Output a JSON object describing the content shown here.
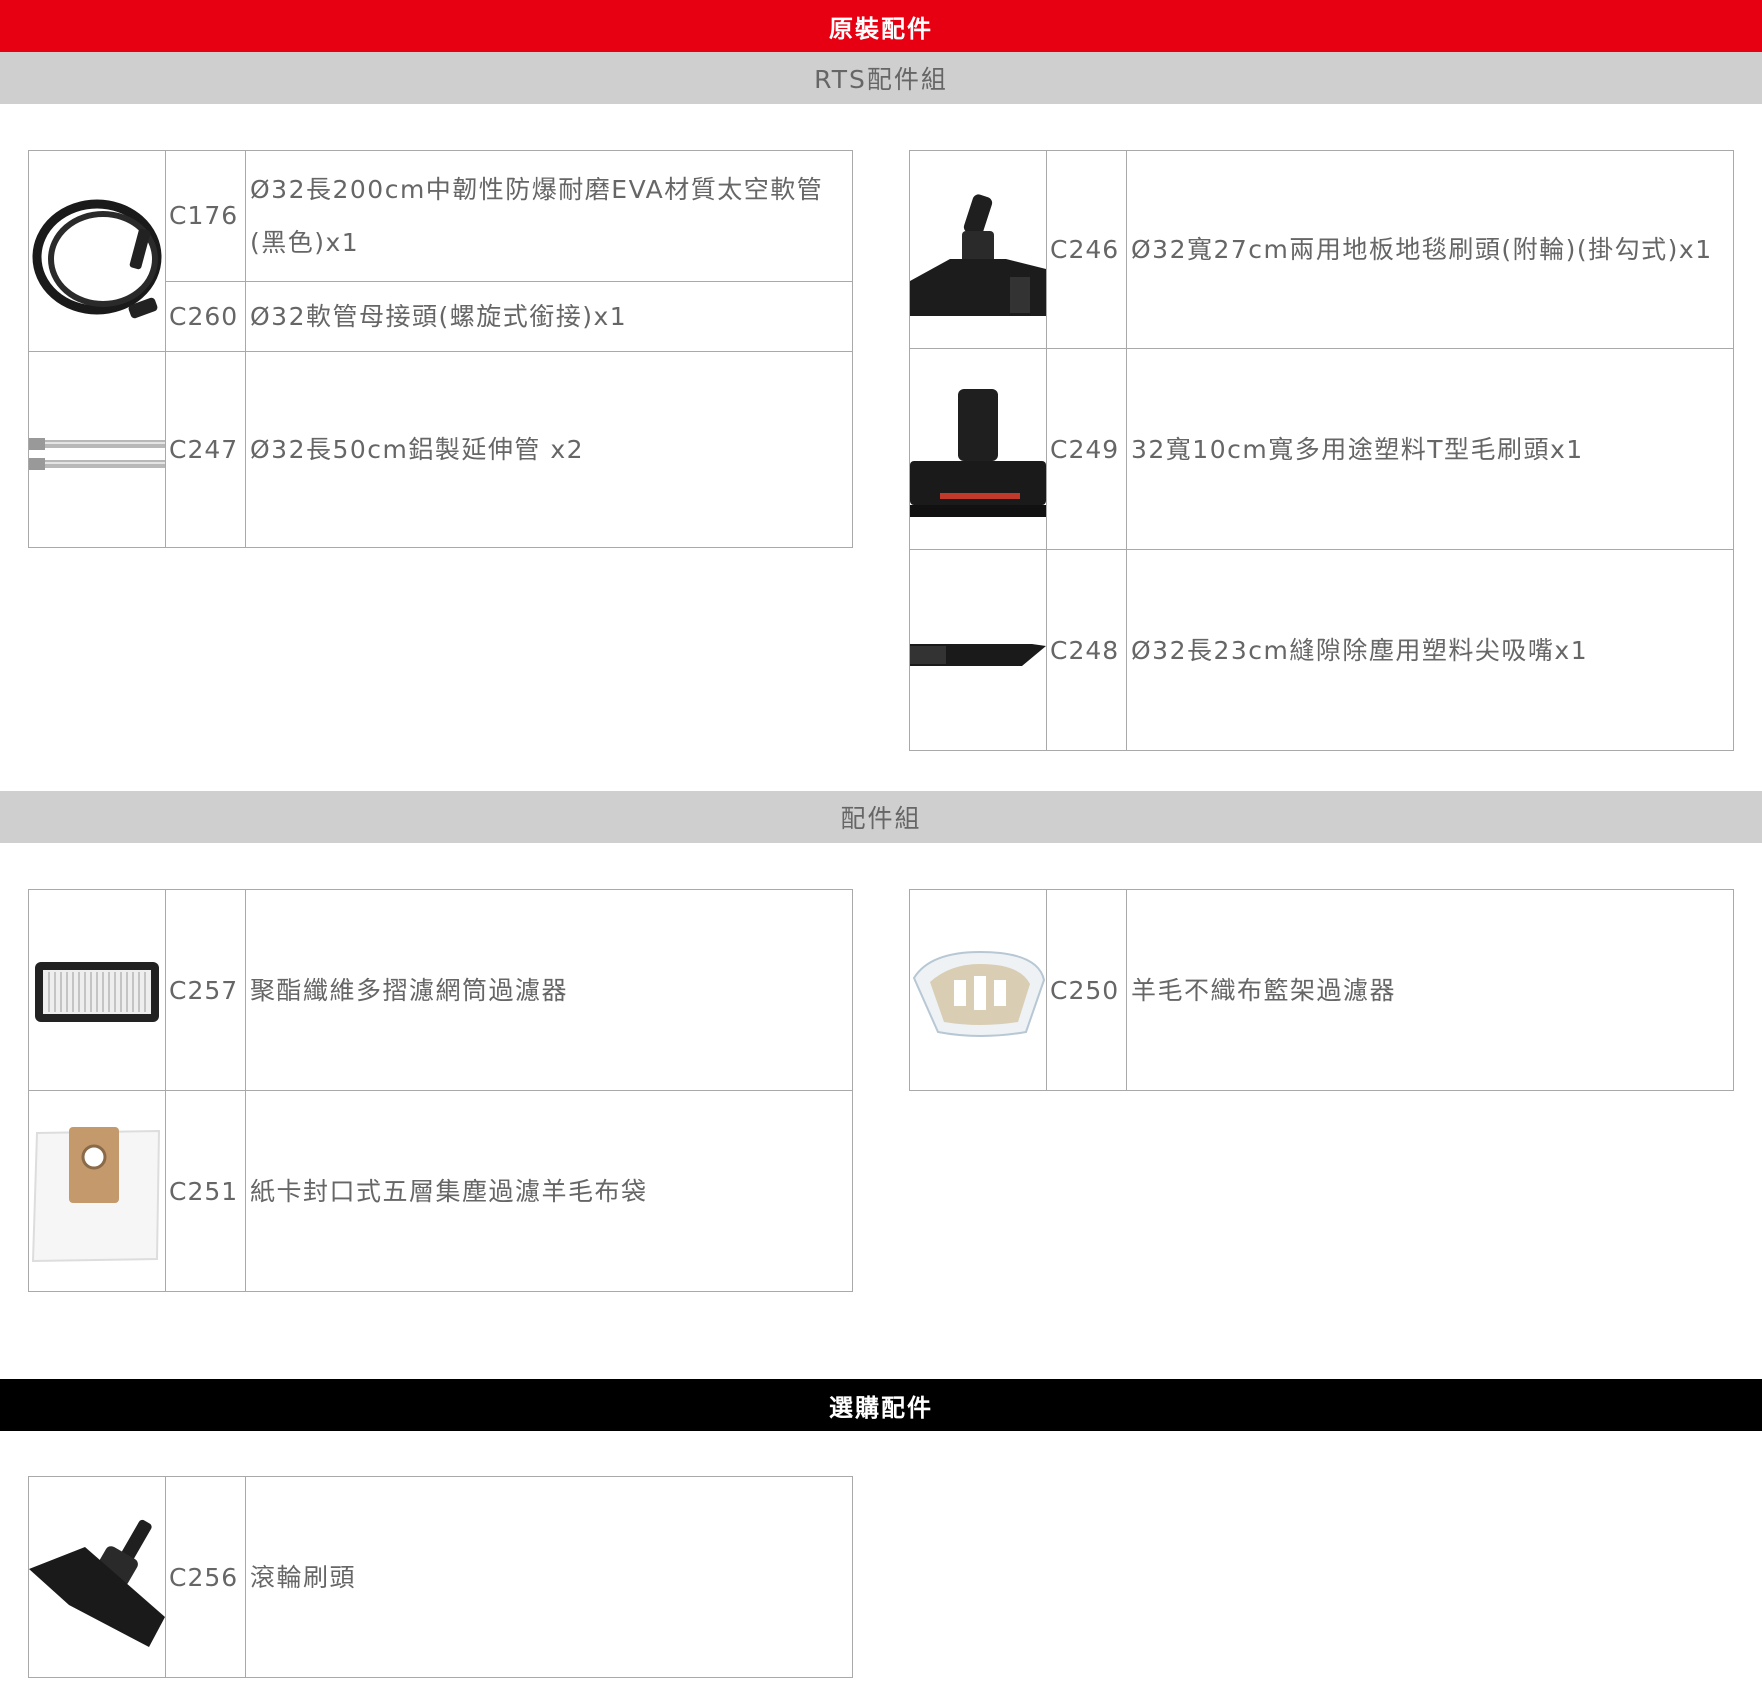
{
  "header": {
    "title": "原裝配件"
  },
  "sections": {
    "rts": {
      "title": "RTS配件組"
    },
    "kit": {
      "title": "配件組"
    },
    "optional": {
      "title": "選購配件"
    }
  },
  "items": {
    "c176": {
      "code": "C176",
      "desc": "Ø32長200cm中韌性防爆耐磨EVA材質太空軟管(黑色)x1",
      "icon": "hose-icon"
    },
    "c260": {
      "code": "C260",
      "desc": "Ø32軟管母接頭(螺旋式銜接)x1"
    },
    "c247": {
      "code": "C247",
      "desc": "Ø32長50cm鋁製延伸管 x2",
      "icon": "extension-tube-icon"
    },
    "c246": {
      "code": "C246",
      "desc": "Ø32寬27cm兩用地板地毯刷頭(附輪)(掛勾式)x1",
      "icon": "floor-brush-icon"
    },
    "c249": {
      "code": "C249",
      "desc": "32寬10cm寬多用途塑料T型毛刷頭x1",
      "icon": "t-brush-icon"
    },
    "c248": {
      "code": "C248",
      "desc": "Ø32長23cm縫隙除塵用塑料尖吸嘴x1",
      "icon": "crevice-nozzle-icon"
    },
    "c257": {
      "code": "C257",
      "desc": "聚酯纖維多摺濾網筒過濾器",
      "icon": "pleated-filter-icon"
    },
    "c250": {
      "code": "C250",
      "desc": "羊毛不織布籃架過濾器",
      "icon": "basket-filter-icon"
    },
    "c251": {
      "code": "C251",
      "desc": "紙卡封口式五層集塵過濾羊毛布袋",
      "icon": "dust-bag-icon"
    },
    "c256": {
      "code": "C256",
      "desc": "滾輪刷頭",
      "icon": "roller-brush-icon"
    }
  },
  "colors": {
    "red": "#e60012",
    "gray": "#cfcfcf",
    "black": "#000000",
    "border": "#a9a9a9"
  }
}
